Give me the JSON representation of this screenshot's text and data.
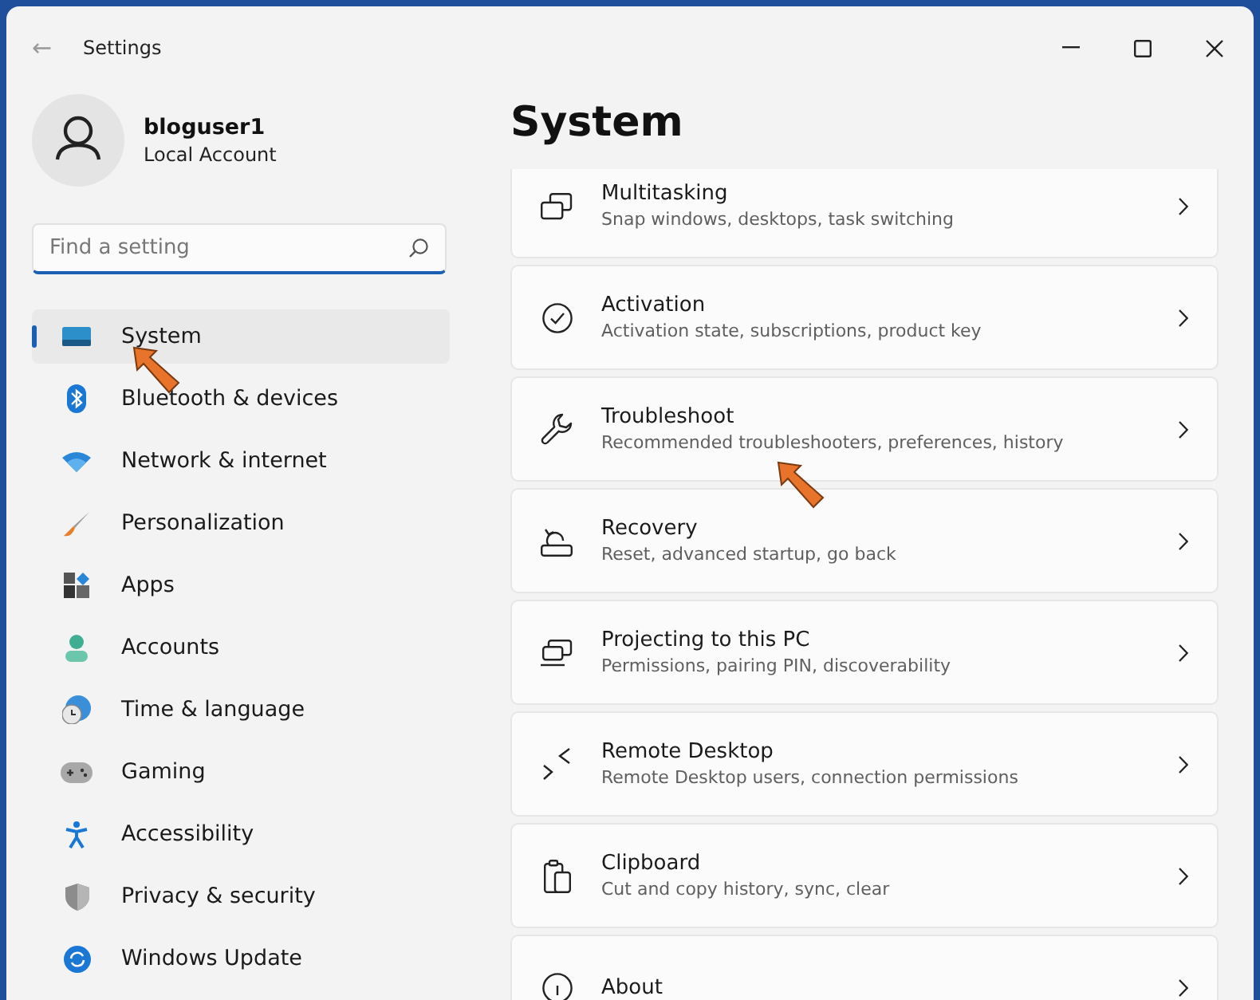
{
  "window": {
    "title": "Settings",
    "back": "←"
  },
  "account": {
    "name": "bloguser1",
    "type": "Local Account"
  },
  "search": {
    "placeholder": "Find a setting"
  },
  "nav": [
    {
      "label": "System",
      "selected": true,
      "pointer": true
    },
    {
      "label": "Bluetooth & devices",
      "selected": false,
      "pointer": false
    },
    {
      "label": "Network & internet",
      "selected": false,
      "pointer": false
    },
    {
      "label": "Personalization",
      "selected": false,
      "pointer": false
    },
    {
      "label": "Apps",
      "selected": false,
      "pointer": false
    },
    {
      "label": "Accounts",
      "selected": false,
      "pointer": false
    },
    {
      "label": "Time & language",
      "selected": false,
      "pointer": false
    },
    {
      "label": "Gaming",
      "selected": false,
      "pointer": false
    },
    {
      "label": "Accessibility",
      "selected": false,
      "pointer": false
    },
    {
      "label": "Privacy & security",
      "selected": false,
      "pointer": false
    },
    {
      "label": "Windows Update",
      "selected": false,
      "pointer": false
    }
  ],
  "page": {
    "title": "System"
  },
  "items": [
    {
      "title": "Multitasking",
      "subtitle": "Snap windows, desktops, task switching",
      "pointer": false
    },
    {
      "title": "Activation",
      "subtitle": "Activation state, subscriptions, product key",
      "pointer": false
    },
    {
      "title": "Troubleshoot",
      "subtitle": "Recommended troubleshooters, preferences, history",
      "pointer": true
    },
    {
      "title": "Recovery",
      "subtitle": "Reset, advanced startup, go back",
      "pointer": false
    },
    {
      "title": "Projecting to this PC",
      "subtitle": "Permissions, pairing PIN, discoverability",
      "pointer": false
    },
    {
      "title": "Remote Desktop",
      "subtitle": "Remote Desktop users, connection permissions",
      "pointer": false
    },
    {
      "title": "Clipboard",
      "subtitle": "Cut and copy history, sync, clear",
      "pointer": false
    },
    {
      "title": "About",
      "pointer": false
    }
  ]
}
